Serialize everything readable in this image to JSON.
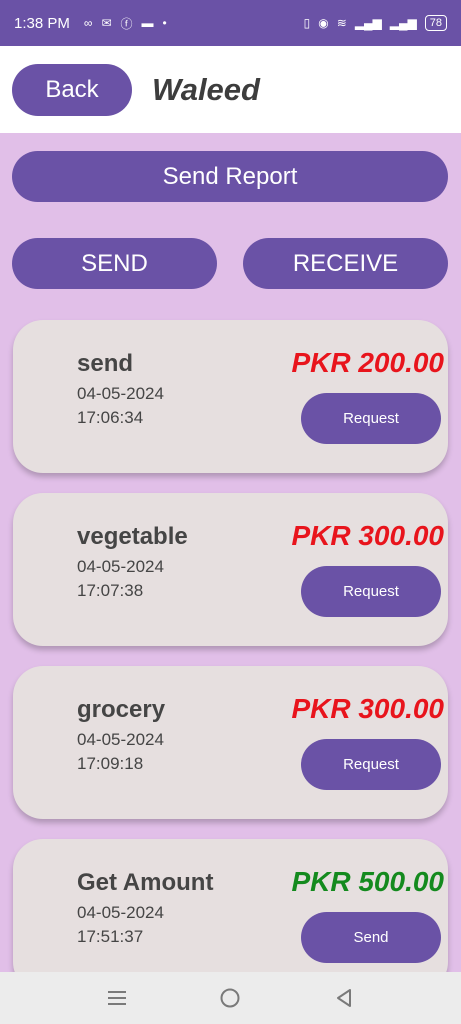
{
  "status": {
    "time": "1:38 PM",
    "battery": "78"
  },
  "header": {
    "back_label": "Back",
    "title": "Waleed"
  },
  "report_button": "Send Report",
  "tabs": {
    "send": "SEND",
    "receive": "RECEIVE"
  },
  "transactions": [
    {
      "title": "send",
      "date": "04-05-2024",
      "time": "17:06:34",
      "amount": "PKR 200.00",
      "action": "Request",
      "amount_color": "#e8141c"
    },
    {
      "title": "vegetable",
      "date": "04-05-2024",
      "time": "17:07:38",
      "amount": "PKR 300.00",
      "action": "Request",
      "amount_color": "#e8141c"
    },
    {
      "title": "grocery",
      "date": "04-05-2024",
      "time": "17:09:18",
      "amount": "PKR 300.00",
      "action": "Request",
      "amount_color": "#e8141c"
    },
    {
      "title": "Get Amount",
      "date": "04-05-2024",
      "time": "17:51:37",
      "amount": "PKR 500.00",
      "action": "Send",
      "amount_color": "#148a1e"
    }
  ],
  "nav": {
    "recents": "menu-icon",
    "home": "home-circle-icon",
    "back": "back-triangle-icon"
  },
  "colors": {
    "primary": "#6a52a6",
    "background": "#e1bfe8",
    "card": "#e6dfdf"
  }
}
